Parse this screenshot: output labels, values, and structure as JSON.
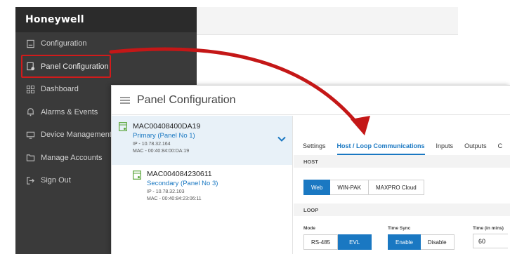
{
  "brand": "Honeywell",
  "sidebar": {
    "items": [
      {
        "label": "Configuration",
        "icon": "file-icon"
      },
      {
        "label": "Panel Configuration",
        "icon": "panel-config-icon"
      },
      {
        "label": "Dashboard",
        "icon": "grid-icon"
      },
      {
        "label": "Alarms & Events",
        "icon": "bell-icon"
      },
      {
        "label": "Device Management",
        "icon": "device-icon"
      },
      {
        "label": "Manage Accounts",
        "icon": "folder-icon"
      },
      {
        "label": "Sign Out",
        "icon": "sign-out-icon"
      }
    ]
  },
  "panel": {
    "title": "Panel Configuration",
    "devices": [
      {
        "mac": "MAC00408400DA19",
        "role": "Primary (Panel No 1)",
        "ip": "IP - 10.78.32.164",
        "macaddr": "MAC - 00:40:84:00:DA:19"
      },
      {
        "mac": "MAC004084230611",
        "role": "Secondary (Panel No 3)",
        "ip": "IP - 10.78.32.103",
        "macaddr": "MAC - 00:40:84:23:06:11"
      }
    ],
    "tabs": [
      "Settings",
      "Host / Loop Communications",
      "Inputs",
      "Outputs",
      "C"
    ],
    "active_tab": "Host / Loop Communications",
    "host": {
      "section": "HOST",
      "options": [
        "Web",
        "WIN-PAK",
        "MAXPRO Cloud"
      ],
      "selected": "Web"
    },
    "loop": {
      "section": "LOOP",
      "mode_label": "Mode",
      "mode_options": [
        "RS-485",
        "EVL"
      ],
      "mode_selected": "EVL",
      "sync_label": "Time Sync",
      "sync_options": [
        "Enable",
        "Disable"
      ],
      "sync_selected": "Enable",
      "time_label": "Time (in mins)",
      "time_value": "60"
    }
  },
  "colors": {
    "accent": "#1a78c2",
    "sidebar": "#3a3a3a",
    "highlight": "#d11b1b"
  }
}
